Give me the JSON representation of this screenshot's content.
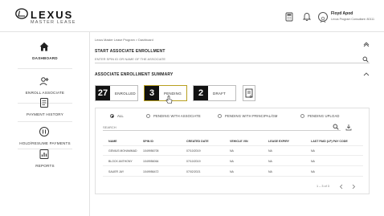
{
  "header": {
    "logo_text": "LEXUS",
    "logo_sub": "MASTER LEASE",
    "user_name": "Floyd Apod",
    "user_role": "Lexus Program Consultant: 80111"
  },
  "sidebar": {
    "items": [
      {
        "label": "DASHBOARD",
        "icon": "home-icon",
        "active": true
      },
      {
        "label": "ENROLL ASSOCIATE",
        "icon": "enroll-icon",
        "active": false
      },
      {
        "label": "PAYMENT HISTORY",
        "icon": "payment-history-icon",
        "active": false
      },
      {
        "label": "HOLD/RESUME PAYMENTS",
        "icon": "hold-resume-icon",
        "active": false
      },
      {
        "label": "REPORTS",
        "icon": "reports-icon",
        "active": false
      }
    ]
  },
  "breadcrumb": "Lexus Master Lease Program > Dashboard",
  "enroll": {
    "title": "START ASSOCIATE ENROLLMENT",
    "placeholder": "ENTER SPIN ID OR NAME OF THE ASSOCIATE"
  },
  "summary": {
    "title": "ASSOCIATE ENROLLMENT SUMMARY",
    "tiles": [
      {
        "count": "27",
        "label": "ENROLLED"
      },
      {
        "count": "3",
        "label": "PENDING"
      },
      {
        "count": "2",
        "label": "DRAFT"
      }
    ]
  },
  "filters": {
    "options": [
      {
        "label": "ALL",
        "selected": true
      },
      {
        "label": "PENDING WITH ASSOCIATE",
        "selected": false
      },
      {
        "label": "PENDING WITH PRINCIPAL/GM",
        "selected": false
      },
      {
        "label": "PENDING UPLOAD",
        "selected": false
      }
    ],
    "search_placeholder": "SEARCH"
  },
  "table": {
    "headers": [
      "NAME",
      "SPIN ID",
      "CREATED DATE",
      "VEHICLE VIN",
      "LEASE EXPIRY",
      "LAST PAID (LP) PAY CODE"
    ],
    "rows": [
      [
        "GENIUS MOHAMMAD",
        "1049956705",
        "07/10/2019",
        "NA",
        "NA",
        "NA"
      ],
      [
        "BLOCK ANTHONY",
        "1049956064",
        "07/10/2019",
        "NA",
        "NA",
        "NA"
      ],
      [
        "SAUER JAY",
        "1049956472",
        "07/02/2021",
        "NA",
        "NA",
        "NA"
      ]
    ],
    "pagination": "1 – 3 of 3"
  },
  "colors": {
    "accent": "#b8a020",
    "tile_number_bg": "#111111"
  }
}
